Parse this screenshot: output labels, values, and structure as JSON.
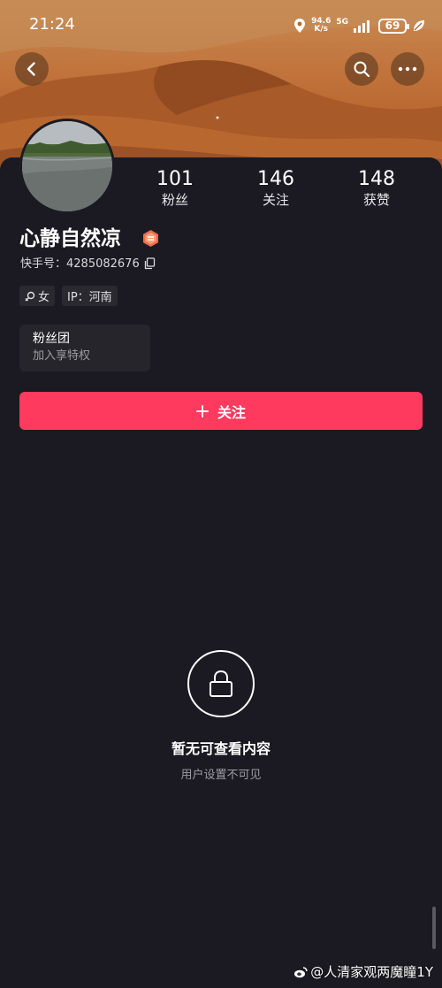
{
  "status_bar": {
    "time": "21:24",
    "net_speed_value": "94.6",
    "net_speed_unit": "K/s",
    "network": "5G",
    "battery": "69"
  },
  "header": {
    "back_icon": "chevron-left-icon",
    "search_icon": "search-icon",
    "more_icon": "more-dots-icon"
  },
  "profile": {
    "name": "心静自然凉",
    "id_label": "快手号：4285082676",
    "stats": [
      {
        "value": "101",
        "label": "粉丝"
      },
      {
        "value": "146",
        "label": "关注"
      },
      {
        "value": "148",
        "label": "获赞"
      }
    ],
    "tags": {
      "gender": "女",
      "ip": "IP：河南"
    }
  },
  "fan_group": {
    "title": "粉丝团",
    "subtitle": "加入享特权"
  },
  "follow_button": {
    "label": "关注"
  },
  "empty_state": {
    "title": "暂无可查看内容",
    "subtitle": "用户设置不可见"
  },
  "watermark": {
    "text": "@人清家观两魔瞳1Y"
  },
  "colors": {
    "background": "#1b1a22",
    "accent": "#fe3a5f",
    "badge": "#f26b4f"
  }
}
